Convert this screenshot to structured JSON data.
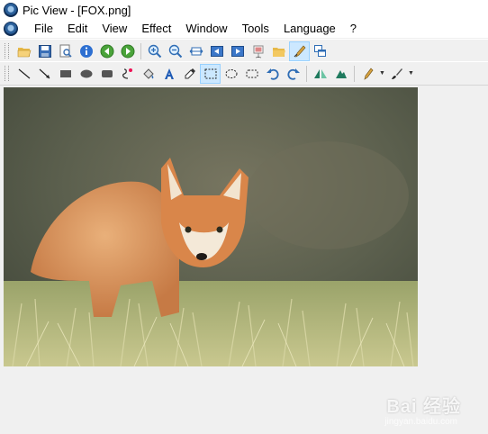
{
  "window": {
    "title": "Pic View - [FOX.png]"
  },
  "menu": {
    "items": [
      {
        "name": "menu-file",
        "label": "File"
      },
      {
        "name": "menu-edit",
        "label": "Edit"
      },
      {
        "name": "menu-view",
        "label": "View"
      },
      {
        "name": "menu-effect",
        "label": "Effect"
      },
      {
        "name": "menu-window",
        "label": "Window"
      },
      {
        "name": "menu-tools",
        "label": "Tools"
      },
      {
        "name": "menu-language",
        "label": "Language"
      },
      {
        "name": "menu-help",
        "label": "?"
      }
    ]
  },
  "toolbar_main": {
    "buttons": [
      "open-folder-icon",
      "save-icon",
      "print-preview-icon",
      "info-icon",
      "rotate-left-icon",
      "rotate-right-icon",
      "zoom-in-icon",
      "zoom-out-icon",
      "fit-width-icon",
      "previous-icon",
      "next-icon",
      "slideshow-icon",
      "open-icon",
      "draw-icon",
      "windows-icon"
    ],
    "active": "draw-icon"
  },
  "toolbar_draw": {
    "buttons": [
      "line-tool-icon",
      "arrow-tool-icon",
      "rectangle-tool-icon",
      "ellipse-tool-icon",
      "rounded-rect-tool-icon",
      "color-replace-icon",
      "fill-tool-icon",
      "text-tool-icon",
      "eyedropper-icon",
      "rect-select-icon",
      "ellipse-select-icon",
      "rounded-select-icon",
      "undo-icon",
      "redo-icon",
      "flip-horizontal-icon",
      "flip-vertical-icon",
      "pencil-icon",
      "brush-icon"
    ],
    "active": "rect-select-icon"
  },
  "image": {
    "description_name": "FOX.png"
  },
  "watermark": {
    "brand": "Bai 经验",
    "url": "jingyan.baidu.com"
  },
  "colors": {
    "selection": "#cce8ff",
    "window_bg": "#f0f0f0"
  }
}
